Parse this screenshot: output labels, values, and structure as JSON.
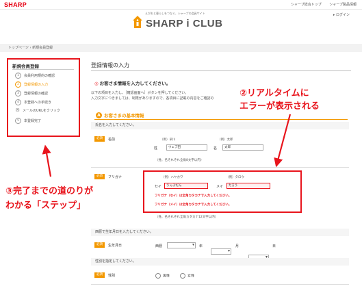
{
  "header": {
    "brand": "SHARP",
    "links": [
      "シャープ総合トップ",
      "シャープ製品情報"
    ],
    "club_name": "SHARP i CLUB",
    "club_tagline": "えがおと暮らしをつなぐ、シャープの会員サイト",
    "login": "ログイン"
  },
  "breadcrumb": [
    "トップページ",
    "新規会員登録"
  ],
  "sidebar": {
    "title": "新規会員登録",
    "steps": [
      {
        "num": "1",
        "label": "会員利用規約の確認"
      },
      {
        "num": "2",
        "label": "登録情報の入力"
      },
      {
        "num": "3",
        "label": "登録情報の確認"
      },
      {
        "num": "4",
        "label": "本登録への手続き"
      },
      {
        "num": "✉",
        "label": "メールのURLをクリック"
      },
      {
        "num": "5",
        "label": "本登録完了"
      }
    ],
    "active_step": 1
  },
  "main": {
    "title": "登録情報の入力",
    "greeting": "お客さま情報を入力してください。",
    "greeting_mark": "◎",
    "intro_line1": "以下の項目を入力し、［確認画面へ］ボタンを押してください。",
    "intro_line2": "入力文字につきましては、制限がありますので、各項目に記載の内容をご確認の",
    "section_badge": "A",
    "section_title": "お客さまの基本情報"
  },
  "name_row": {
    "prompt": "氏名を入力してください。",
    "required": "必須",
    "label": "名前",
    "sei_example": "（例）早川",
    "mei_example": "（例）太郎",
    "sei_label": "姓",
    "mei_label": "名",
    "sei_value": "ウェブ田",
    "mei_value": "太郎",
    "note": "（姓、名それぞれ全角8文字以内）"
  },
  "kana_row": {
    "required": "必須",
    "label": "フリガナ",
    "sei_example": "（例）ハヤカワ",
    "mei_example": "（例）タロウ",
    "sei_label": "セイ",
    "mei_label": "メイ",
    "sei_value": "うぇぶだん",
    "mei_value": "たろう",
    "error_sei": "フリガナ（セイ）は全角カタカナで入力してください。",
    "error_mei": "フリガナ（メイ）は全角カタカナで入力してください。",
    "note": "（姓、名それぞれ全角カタカナ12文字以内）"
  },
  "birth_row": {
    "prompt": "西暦で生年月日を入力してください。",
    "required": "必須",
    "label": "生年月日",
    "era": "西暦",
    "year_unit": "年",
    "month_unit": "月",
    "day_unit": "日"
  },
  "gender_row": {
    "prompt": "性別を指定してください。",
    "required": "必須",
    "label": "性別",
    "options": [
      "男性",
      "女性"
    ]
  },
  "annotations": {
    "realtime_line1": "②リアルタイムに",
    "realtime_line2": "エラーが表示される",
    "steps_line1": "③完了までの道のりが",
    "steps_line2": "わかる「ステップ」"
  },
  "colors": {
    "accent": "#f39800",
    "error": "#e8141c",
    "brand": "#e60012"
  }
}
